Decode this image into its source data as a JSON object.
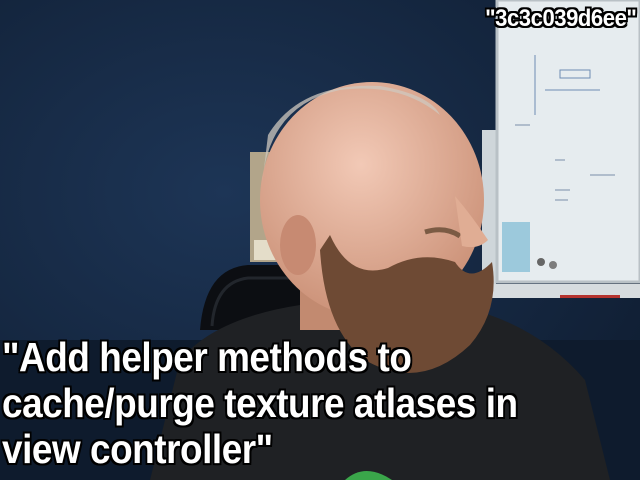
{
  "commit_hash": "\"3c3c039d6ee\"",
  "commit_message": "\"Add helper methods to\ncache/purge texture atlases in\nview controller\"",
  "colors": {
    "wall": "#14263e",
    "whiteboard": "#e8eef0",
    "skin": "#d9a58c",
    "beard": "#6e4a34",
    "shirt": "#1f2124"
  }
}
